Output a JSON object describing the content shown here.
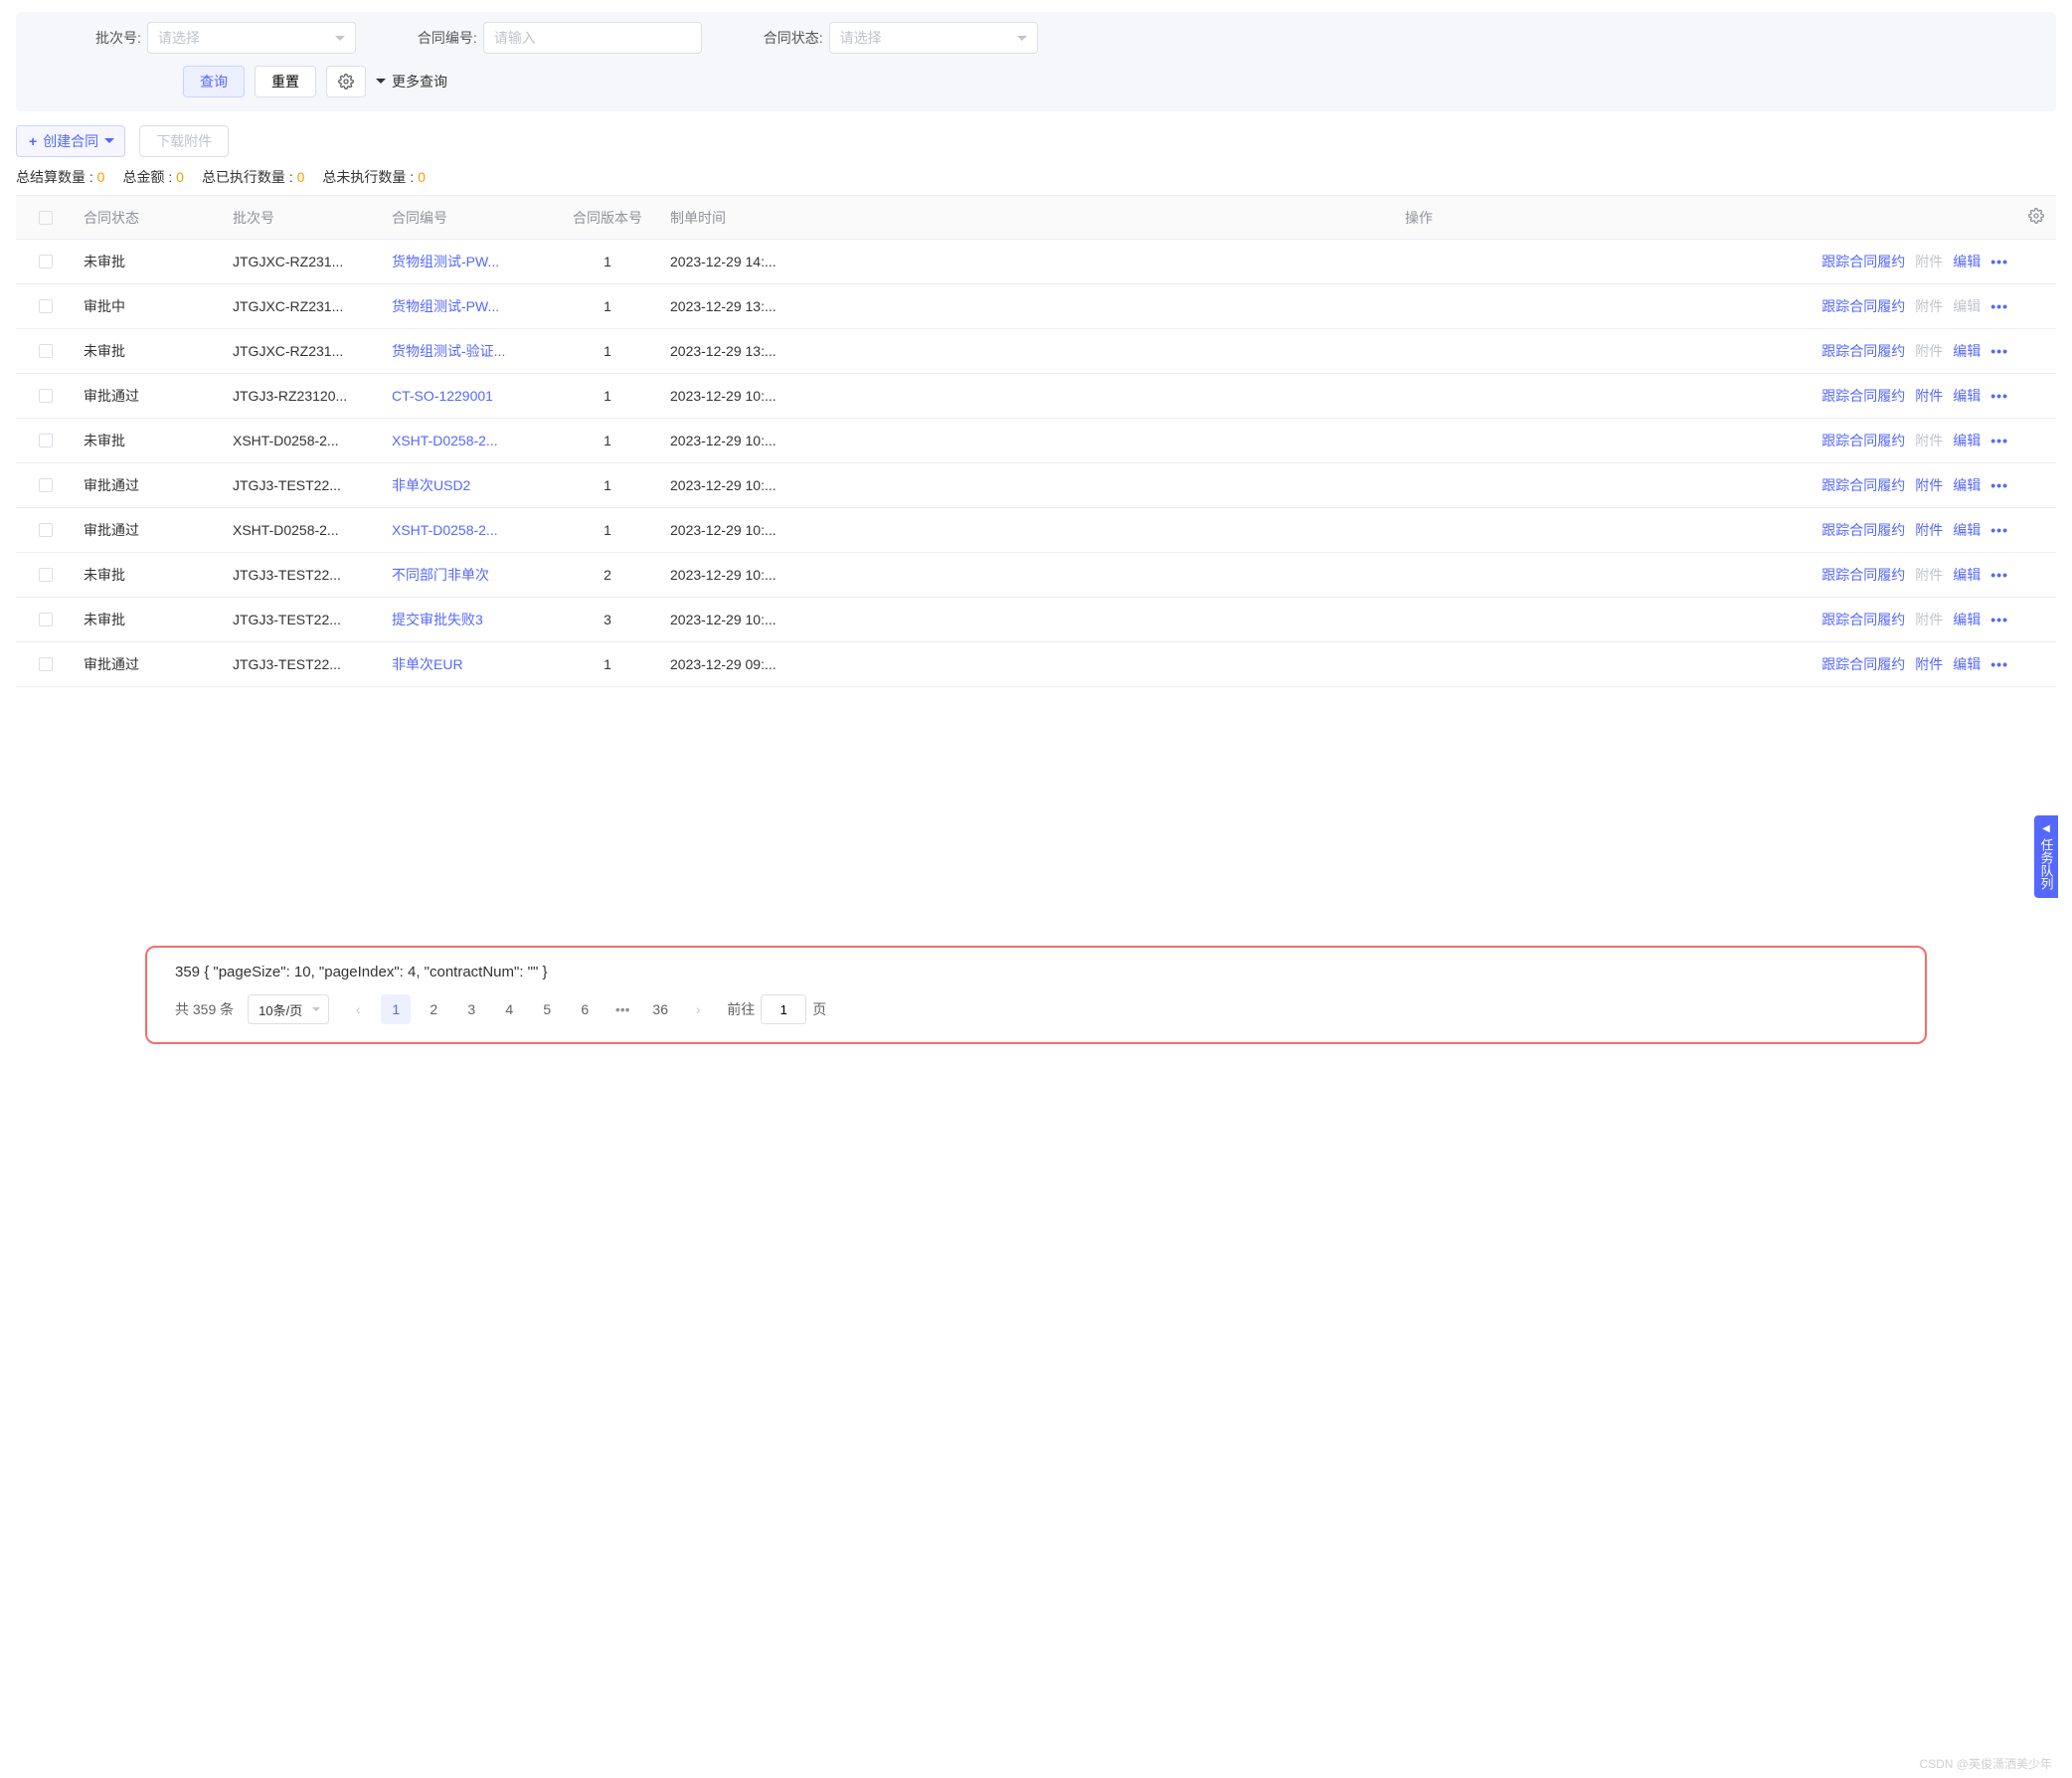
{
  "filters": {
    "batch_label": "批次号:",
    "batch_placeholder": "请选择",
    "contract_no_label": "合同编号:",
    "contract_no_placeholder": "请输入",
    "contract_status_label": "合同状态:",
    "contract_status_placeholder": "请选择"
  },
  "buttons": {
    "query": "查询",
    "reset": "重置",
    "more_query": "更多查询",
    "create_contract": "创建合同",
    "download_attach": "下载附件"
  },
  "summary": {
    "total_settle_label": "总结算数量 :",
    "total_settle_value": "0",
    "total_amount_label": "总金额 :",
    "total_amount_value": "0",
    "total_exec_label": "总已执行数量 :",
    "total_exec_value": "0",
    "total_unexec_label": "总未执行数量 :",
    "total_unexec_value": "0"
  },
  "columns": {
    "status": "合同状态",
    "batch": "批次号",
    "contract_no": "合同编号",
    "version": "合同版本号",
    "create_time": "制单时间",
    "ops": "操作"
  },
  "ops_labels": {
    "track": "跟踪合同履约",
    "attach": "附件",
    "edit": "编辑"
  },
  "rows": [
    {
      "status": "未审批",
      "batch": "JTGJXC-RZ231...",
      "contract_no": "货物组测试-PW...",
      "version": "1",
      "time": "2023-12-29 14:...",
      "attach_enabled": false
    },
    {
      "status": "审批中",
      "batch": "JTGJXC-RZ231...",
      "contract_no": "货物组测试-PW...",
      "version": "1",
      "time": "2023-12-29 13:...",
      "attach_enabled": false,
      "edit_disabled": true
    },
    {
      "status": "未审批",
      "batch": "JTGJXC-RZ231...",
      "contract_no": "货物组测试-验证...",
      "version": "1",
      "time": "2023-12-29 13:...",
      "attach_enabled": false
    },
    {
      "status": "审批通过",
      "batch": "JTGJ3-RZ23120...",
      "contract_no": "CT-SO-1229001",
      "version": "1",
      "time": "2023-12-29 10:...",
      "attach_enabled": true
    },
    {
      "status": "未审批",
      "batch": "XSHT-D0258-2...",
      "contract_no": "XSHT-D0258-2...",
      "version": "1",
      "time": "2023-12-29 10:...",
      "attach_enabled": false
    },
    {
      "status": "审批通过",
      "batch": "JTGJ3-TEST22...",
      "contract_no": "非单次USD2",
      "version": "1",
      "time": "2023-12-29 10:...",
      "attach_enabled": true
    },
    {
      "status": "审批通过",
      "batch": "XSHT-D0258-2...",
      "contract_no": "XSHT-D0258-2...",
      "version": "1",
      "time": "2023-12-29 10:...",
      "attach_enabled": true
    },
    {
      "status": "未审批",
      "batch": "JTGJ3-TEST22...",
      "contract_no": "不同部门非单次",
      "version": "2",
      "time": "2023-12-29 10:...",
      "attach_enabled": false
    },
    {
      "status": "未审批",
      "batch": "JTGJ3-TEST22...",
      "contract_no": "提交审批失败3",
      "version": "3",
      "time": "2023-12-29 10:...",
      "attach_enabled": false
    },
    {
      "status": "审批通过",
      "batch": "JTGJ3-TEST22...",
      "contract_no": "非单次EUR",
      "version": "1",
      "time": "2023-12-29 09:...",
      "attach_enabled": true
    }
  ],
  "task_panel": "任务队列",
  "debug_text": "359 { \"pageSize\": 10, \"pageIndex\": 4, \"contractNum\": \"\" }",
  "pagination": {
    "total_text": "共 359 条",
    "page_size": "10条/页",
    "pages": [
      "1",
      "2",
      "3",
      "4",
      "5",
      "6",
      "...",
      "36"
    ],
    "active_page": "1",
    "jump_prefix": "前往",
    "jump_value": "1",
    "jump_suffix": "页"
  },
  "watermark": "CSDN @英俊潇洒美少年"
}
